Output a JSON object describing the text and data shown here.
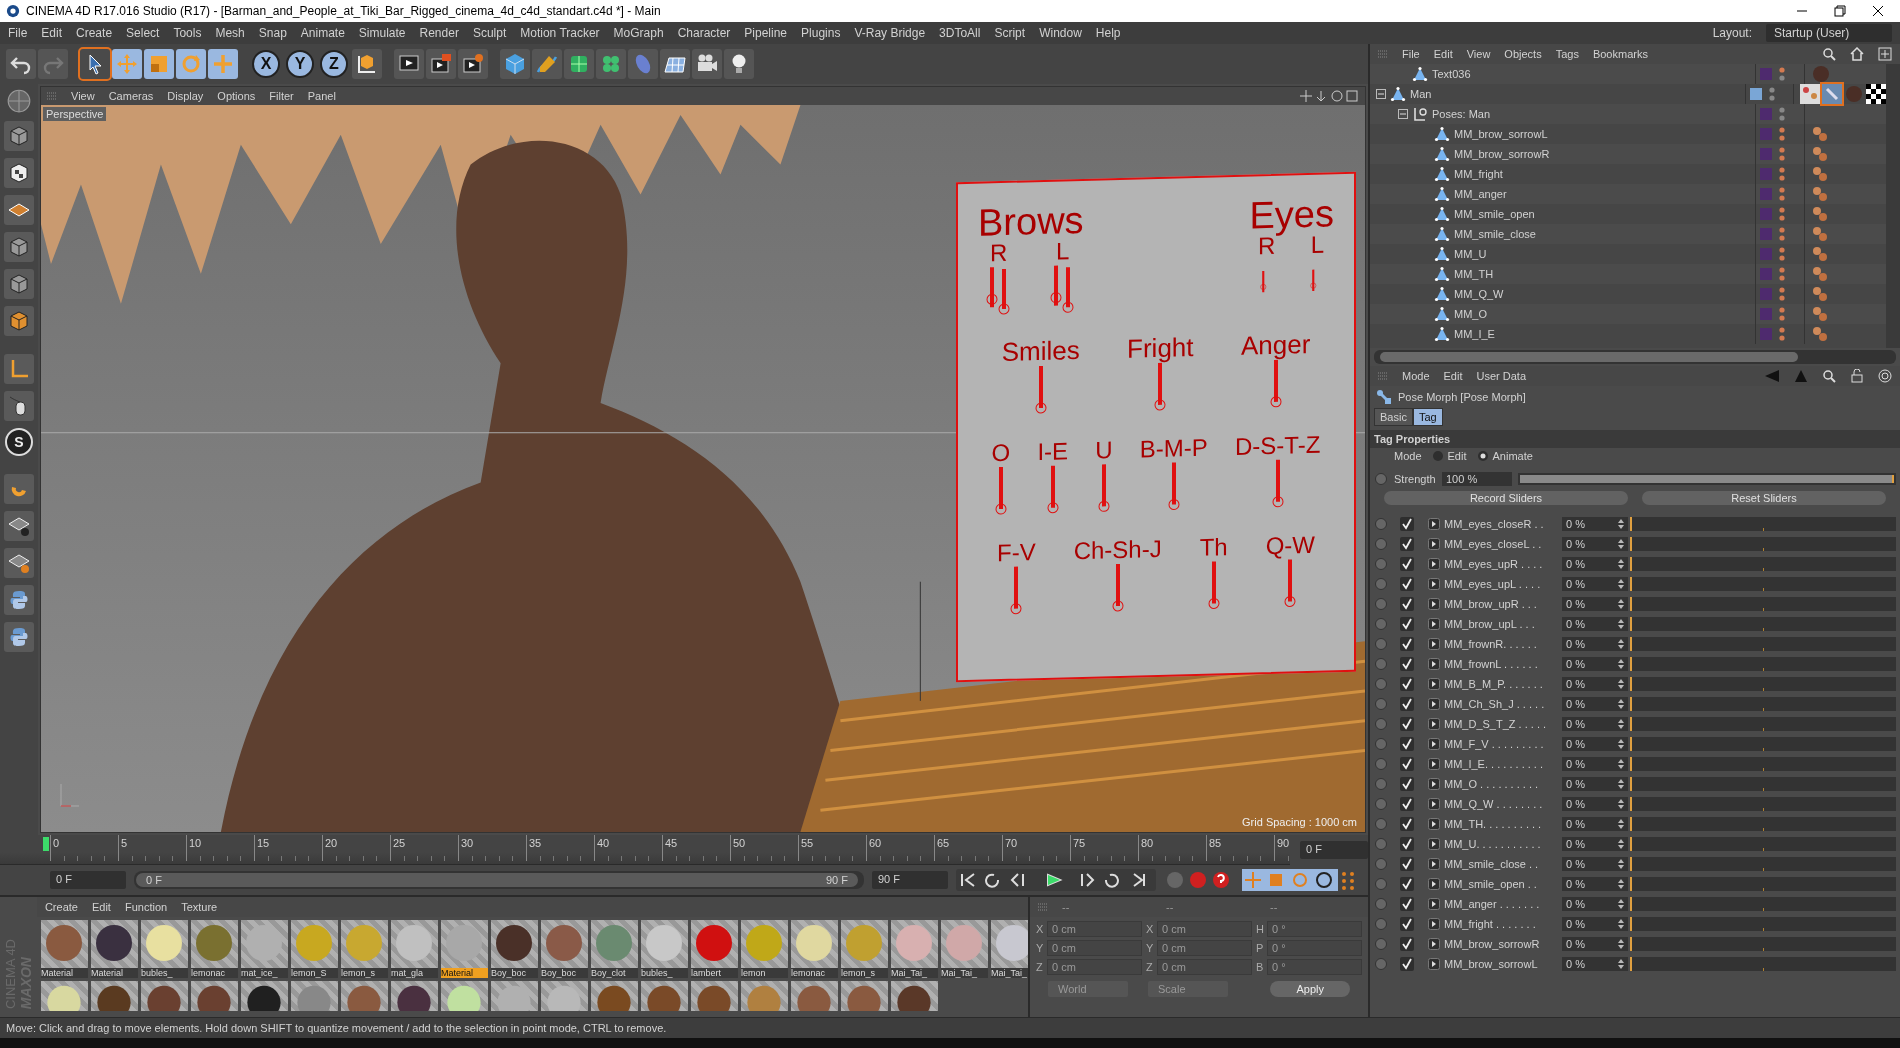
{
  "window": {
    "title": "CINEMA 4D R17.016 Studio (R17) - [Barman_and_People_at_Tiki_Bar_Rigged_cinema_4d_c4d_standart.c4d *] - Main"
  },
  "menu": [
    "File",
    "Edit",
    "Create",
    "Select",
    "Tools",
    "Mesh",
    "Snap",
    "Animate",
    "Simulate",
    "Render",
    "Sculpt",
    "Motion Tracker",
    "MoGraph",
    "Character",
    "Pipeline",
    "Plugins",
    "V-Ray Bridge",
    "3DToAll",
    "Script",
    "Window",
    "Help"
  ],
  "layout": {
    "label": "Layout:",
    "value": "Startup (User)"
  },
  "axis_buttons": [
    "X",
    "Y",
    "Z"
  ],
  "left_toolbar_letter": "S",
  "viewport": {
    "menu": [
      "View",
      "Cameras",
      "Display",
      "Options",
      "Filter",
      "Panel"
    ],
    "camera": "Perspective",
    "grid_spacing": "Grid Spacing : 1000 cm",
    "board": {
      "sections": [
        {
          "title": "Brows",
          "controls": [
            {
              "label": "R",
              "kind": "double"
            },
            {
              "label": "L",
              "kind": "double"
            }
          ]
        },
        {
          "title": "Eyes",
          "controls": [
            {
              "label": "R",
              "kind": "single"
            },
            {
              "label": "L",
              "kind": "single"
            }
          ]
        }
      ],
      "groups": [
        {
          "labels": [
            "Smiles",
            "Fright",
            "Anger"
          ]
        },
        {
          "labels": [
            "O",
            "I-E",
            "U",
            "B-M-P",
            "D-S-T-Z"
          ]
        },
        {
          "labels": [
            "F-V",
            "Ch-Sh-J",
            "Th",
            "Q-W"
          ]
        }
      ]
    }
  },
  "timeline": {
    "ticks": [
      "0",
      "5",
      "10",
      "15",
      "20",
      "25",
      "30",
      "35",
      "40",
      "45",
      "50",
      "55",
      "60",
      "65",
      "70",
      "75",
      "80",
      "85",
      "90"
    ],
    "current": "0 F",
    "start": "0 F",
    "range": {
      "start": "0 F",
      "end": "90 F",
      "level": 1
    },
    "end": "90 F"
  },
  "materials": {
    "menu": [
      "Create",
      "Edit",
      "Function",
      "Texture"
    ],
    "items": [
      {
        "label": "Material",
        "color": "#8a5a40",
        "selected": false
      },
      {
        "label": "Material",
        "color": "#3a3040",
        "selected": false
      },
      {
        "label": "bubles_",
        "color": "#e8e0a0",
        "selected": false
      },
      {
        "label": "lemonac",
        "color": "#7a7030",
        "selected": false
      },
      {
        "label": "mat_ice_",
        "color": "#b0b0b0",
        "selected": false
      },
      {
        "label": "lemon_S",
        "color": "#c8a820",
        "selected": false
      },
      {
        "label": "lemon_s",
        "color": "#c8a830",
        "selected": false
      },
      {
        "label": "mat_gla",
        "color": "#c0c0c0",
        "selected": false
      },
      {
        "label": "Material",
        "color": "#a8a8a8",
        "selected": true
      },
      {
        "label": "Boy_boc",
        "color": "#4a3028",
        "selected": false
      },
      {
        "label": "Boy_boc",
        "color": "#8a5a48",
        "selected": false
      },
      {
        "label": "Boy_clot",
        "color": "#6a8a70",
        "selected": false
      },
      {
        "label": "bubles_",
        "color": "#c8c8c8",
        "selected": false
      },
      {
        "label": "lambert",
        "color": "#d01010",
        "selected": false
      },
      {
        "label": "lemon",
        "color": "#c0a818",
        "selected": false
      },
      {
        "label": "lemonac",
        "color": "#e0d8a0",
        "selected": false
      },
      {
        "label": "lemon_s",
        "color": "#c0a030",
        "selected": false
      },
      {
        "label": "Mai_Tai_",
        "color": "#d8b0b0",
        "selected": false
      },
      {
        "label": "Mai_Tai_",
        "color": "#d0a8a8",
        "selected": false
      },
      {
        "label": "Mai_Tai_",
        "color": "#c8c8d0",
        "selected": false
      }
    ],
    "second_row": [
      {
        "color": "#d8d8a0"
      },
      {
        "color": "#5a3a20"
      },
      {
        "color": "#6a4030"
      },
      {
        "color": "#6a4030"
      },
      {
        "color": "#202020"
      },
      {
        "color": "#888888"
      },
      {
        "color": "#8a5a40"
      },
      {
        "color": "#4a3040"
      },
      {
        "color": "#c0e0a0"
      },
      {
        "color": "#b0b0b0"
      },
      {
        "color": "#b8b8b8"
      },
      {
        "color": "#7a4a20"
      },
      {
        "color": "#7a4a28"
      },
      {
        "color": "#7a4a28"
      },
      {
        "color": "#b08040"
      },
      {
        "color": "#8a5a40"
      },
      {
        "color": "#8a5a40"
      },
      {
        "color": "#5a3828"
      }
    ]
  },
  "coordinates": {
    "headers": [
      "--",
      "--",
      "--"
    ],
    "disabled": true,
    "columns": [
      [
        {
          "axis": "X",
          "value": "0 cm"
        },
        {
          "axis": "Y",
          "value": "0 cm"
        },
        {
          "axis": "Z",
          "value": "0 cm"
        }
      ],
      [
        {
          "axis": "X",
          "value": "0 cm"
        },
        {
          "axis": "Y",
          "value": "0 cm"
        },
        {
          "axis": "Z",
          "value": "0 cm"
        }
      ],
      [
        {
          "axis": "H",
          "value": "0 °"
        },
        {
          "axis": "P",
          "value": "0 °"
        },
        {
          "axis": "B",
          "value": "0 °"
        }
      ]
    ],
    "dropdowns": [
      "World",
      "Scale"
    ],
    "apply": "Apply"
  },
  "status_bar": "Move: Click and drag to move elements. Hold down SHIFT to quantize movement / add to the selection in point mode, CTRL to remove.",
  "objects": {
    "menu": [
      "File",
      "Edit",
      "View",
      "Objects",
      "Tags",
      "Bookmarks"
    ],
    "tree": [
      {
        "name": "Text036",
        "kind": "text",
        "color": "#4e2a6e"
      },
      {
        "name": "Man",
        "kind": "figure",
        "color": "#7aa6d6",
        "expanded": true,
        "children": [
          {
            "name": "Poses: Man",
            "kind": "poses",
            "color": "#4e2a6e",
            "expanded": true,
            "children": [
              {
                "name": "MM_brow_sorrowL",
                "kind": "morph",
                "color": "#4e2a6e"
              },
              {
                "name": "MM_brow_sorrowR",
                "kind": "morph",
                "color": "#4e2a6e"
              },
              {
                "name": "MM_fright",
                "kind": "morph",
                "color": "#4e2a6e"
              },
              {
                "name": "MM_anger",
                "kind": "morph",
                "color": "#4e2a6e"
              },
              {
                "name": "MM_smile_open",
                "kind": "morph",
                "color": "#4e2a6e"
              },
              {
                "name": "MM_smile_close",
                "kind": "morph",
                "color": "#4e2a6e"
              },
              {
                "name": "MM_U",
                "kind": "morph",
                "color": "#4e2a6e"
              },
              {
                "name": "MM_TH",
                "kind": "morph",
                "color": "#4e2a6e"
              },
              {
                "name": "MM_Q_W",
                "kind": "morph",
                "color": "#4e2a6e"
              },
              {
                "name": "MM_O",
                "kind": "morph",
                "color": "#4e2a6e"
              },
              {
                "name": "MM_I_E",
                "kind": "morph",
                "color": "#4e2a6e"
              }
            ]
          }
        ]
      }
    ]
  },
  "attributes": {
    "menu": [
      "Mode",
      "Edit",
      "User Data"
    ],
    "title": "Pose Morph [Pose Morph]",
    "tabs": [
      {
        "label": "Basic",
        "selected": false
      },
      {
        "label": "Tag",
        "selected": true
      }
    ],
    "section": "Tag Properties",
    "mode_label": "Mode",
    "modes": [
      {
        "label": "Edit",
        "selected": false
      },
      {
        "label": "Animate",
        "selected": true
      }
    ],
    "strength": {
      "label": "Strength",
      "value": "100 %",
      "level": 1
    },
    "buttons": [
      "Record Sliders",
      "Reset Sliders"
    ],
    "sliders": [
      {
        "name": "MM_eyes_closeR . .",
        "value": "0 %",
        "level": 0,
        "checked": true
      },
      {
        "name": "MM_eyes_closeL . .",
        "value": "0 %",
        "level": 0,
        "checked": true
      },
      {
        "name": "MM_eyes_upR . . . .",
        "value": "0 %",
        "level": 0,
        "checked": true
      },
      {
        "name": "MM_eyes_upL . . . .",
        "value": "0 %",
        "level": 0,
        "checked": true
      },
      {
        "name": "MM_brow_upR . . .",
        "value": "0 %",
        "level": 0,
        "checked": true
      },
      {
        "name": "MM_brow_upL . . .",
        "value": "0 %",
        "level": 0,
        "checked": true
      },
      {
        "name": "MM_frownR. . . . . .",
        "value": "0 %",
        "level": 0,
        "checked": true
      },
      {
        "name": "MM_frownL . . . . . .",
        "value": "0 %",
        "level": 0,
        "checked": true
      },
      {
        "name": "MM_B_M_P. . . . . . .",
        "value": "0 %",
        "level": 0,
        "checked": true
      },
      {
        "name": "MM_Ch_Sh_J . . . . .",
        "value": "0 %",
        "level": 0,
        "checked": true
      },
      {
        "name": "MM_D_S_T_Z . . . . .",
        "value": "0 %",
        "level": 0,
        "checked": true
      },
      {
        "name": "MM_F_V . . . . . . . . .",
        "value": "0 %",
        "level": 0,
        "checked": true
      },
      {
        "name": "MM_I_E. . . . . . . . . .",
        "value": "0 %",
        "level": 0,
        "checked": true
      },
      {
        "name": "MM_O . . . . . . . . . .",
        "value": "0 %",
        "level": 0,
        "checked": true
      },
      {
        "name": "MM_Q_W . . . . . . . .",
        "value": "0 %",
        "level": 0,
        "checked": true
      },
      {
        "name": "MM_TH. . . . . . . . . .",
        "value": "0 %",
        "level": 0,
        "checked": true
      },
      {
        "name": "MM_U. . . . . . . . . . .",
        "value": "0 %",
        "level": 0,
        "checked": true
      },
      {
        "name": "MM_smile_close . .",
        "value": "0 %",
        "level": 0,
        "checked": true
      },
      {
        "name": "MM_smile_open . .",
        "value": "0 %",
        "level": 0,
        "checked": true
      },
      {
        "name": "MM_anger . . . . . . .",
        "value": "0 %",
        "level": 0,
        "checked": true
      },
      {
        "name": "MM_fright . . . . . . .",
        "value": "0 %",
        "level": 0,
        "checked": true
      },
      {
        "name": "MM_brow_sorrowR",
        "value": "0 %",
        "level": 0,
        "checked": true
      },
      {
        "name": "MM_brow_sorrowL",
        "value": "0 %",
        "level": 0,
        "checked": true
      }
    ]
  },
  "logo": {
    "brand": "MAXON",
    "product": "CINEMA 4D"
  }
}
